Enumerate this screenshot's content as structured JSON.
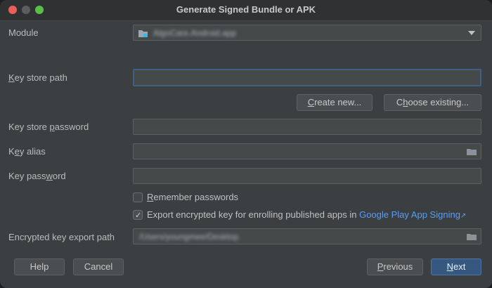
{
  "window": {
    "title": "Generate Signed Bundle or APK"
  },
  "module": {
    "label": "Module",
    "value": "AlgoCare.Android.app"
  },
  "keystore": {
    "path_label": "Key store path",
    "path_value": "",
    "create_new_label": "Create new...",
    "choose_existing_label": "Choose existing...",
    "password_label": "Key store password",
    "password_value": ""
  },
  "key": {
    "alias_label": "Key alias",
    "alias_value": "",
    "password_label": "Key password",
    "password_value": ""
  },
  "options": {
    "remember_label": "Remember passwords",
    "remember_checked": false,
    "export_label": "Export encrypted key for enrolling published apps in",
    "export_link": "Google Play App Signing",
    "export_checked": true
  },
  "export": {
    "path_label": "Encrypted key export path",
    "path_value": "/Users/youngmee/Desktop"
  },
  "footer": {
    "help_label": "Help",
    "cancel_label": "Cancel",
    "previous_label": "Previous",
    "next_label": "Next"
  },
  "colors": {
    "window_bg": "#3c3f41",
    "field_bg": "#45494a",
    "focus_border": "#3d6185",
    "link": "#589df6",
    "primary_button": "#365880"
  }
}
